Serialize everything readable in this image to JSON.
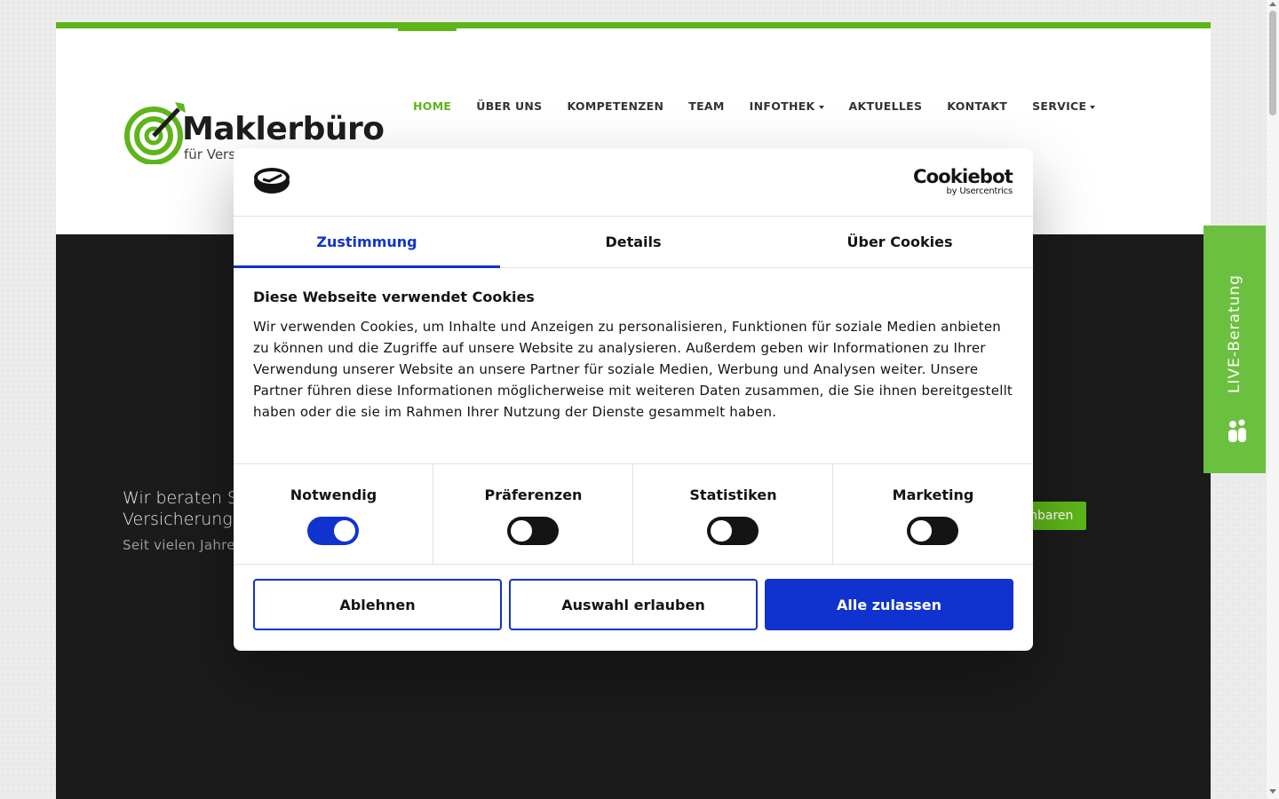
{
  "site": {
    "logo_title": "Maklerbüro",
    "logo_sub": "für Vers",
    "brand_green": "#5db51a"
  },
  "nav": {
    "items": [
      {
        "label": "HOME",
        "active": true
      },
      {
        "label": "ÜBER UNS"
      },
      {
        "label": "KOMPETENZEN"
      },
      {
        "label": "TEAM"
      },
      {
        "label": "INFOTHEK",
        "dropdown": true
      },
      {
        "label": "AKTUELLES"
      },
      {
        "label": "KONTAKT"
      },
      {
        "label": "SERVICE",
        "dropdown": true
      }
    ]
  },
  "hero": {
    "title": "Wir beraten Sie ungebunden in allen privaten und gewerblichen Versicherungsangelegenheiten.",
    "subtitle": "Seit vielen Jahren arbeiten wir mit vielen Klein- und Mittelständischen Unternehmen zusammen.",
    "cta_label": "Jetzt Termin vereinbaren"
  },
  "live_tab": {
    "label": "LIVE-Beratung",
    "icon": "chat-people-icon"
  },
  "cookie_dialog": {
    "brand_name": "Cookiebot",
    "brand_by": "by Usercentrics",
    "accent_color": "#1032cf",
    "tabs": [
      {
        "label": "Zustimmung",
        "active": true
      },
      {
        "label": "Details"
      },
      {
        "label": "Über Cookies"
      }
    ],
    "title": "Diese Webseite verwendet Cookies",
    "text": "Wir verwenden Cookies, um Inhalte und Anzeigen zu personalisieren, Funktionen für soziale Medien anbieten zu können und die Zugriffe auf unsere Website zu analysieren. Außerdem geben wir Informationen zu Ihrer Verwendung unserer Website an unsere Partner für soziale Medien, Werbung und Analysen weiter. Unsere Partner führen diese Informationen möglicherweise mit weiteren Daten zusammen, die Sie ihnen bereitgestellt haben oder die sie im Rahmen Ihrer Nutzung der Dienste gesammelt haben.",
    "toggles": [
      {
        "label": "Notwendig",
        "on": true
      },
      {
        "label": "Präferenzen",
        "on": false
      },
      {
        "label": "Statistiken",
        "on": false
      },
      {
        "label": "Marketing",
        "on": false
      }
    ],
    "buttons": {
      "deny": "Ablehnen",
      "allow_selection": "Auswahl erlauben",
      "allow_all": "Alle zulassen"
    }
  }
}
